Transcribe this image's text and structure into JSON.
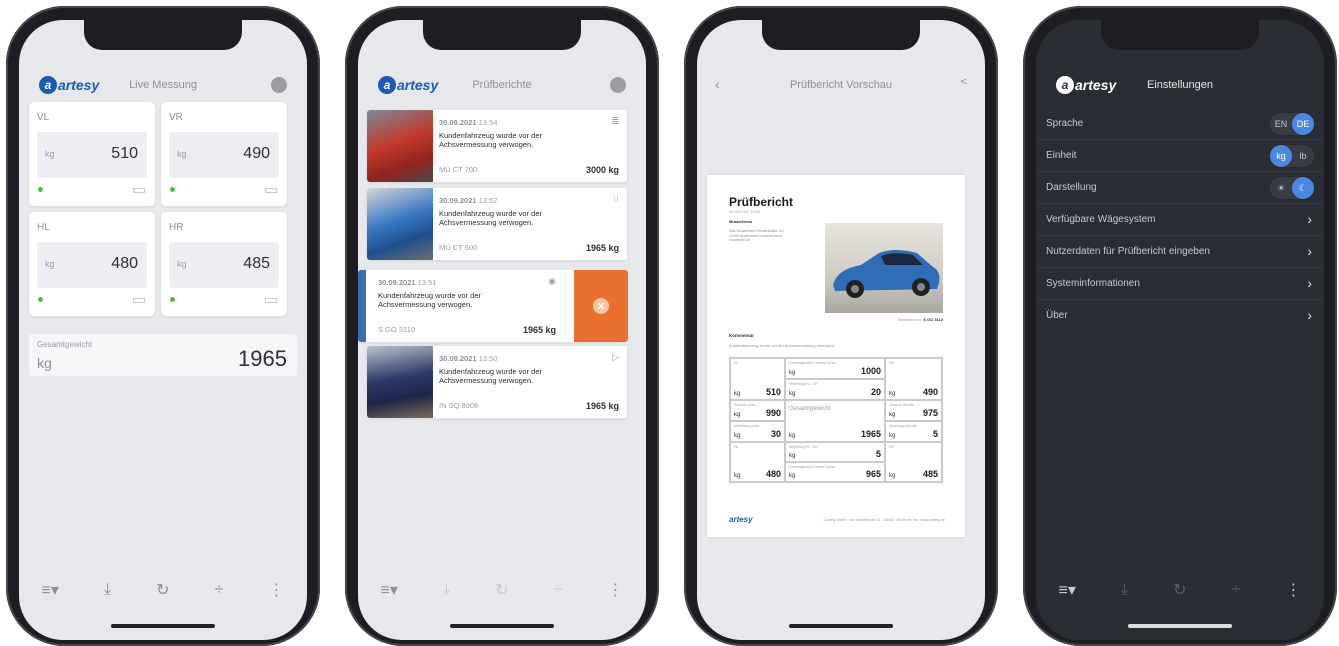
{
  "logo": {
    "text": "artesy",
    "initial": "a"
  },
  "phone1": {
    "title": "Live Messung",
    "cards": [
      {
        "label": "VL",
        "unit": "kg",
        "value": "510"
      },
      {
        "label": "VR",
        "unit": "kg",
        "value": "490"
      },
      {
        "label": "HL",
        "unit": "kg",
        "value": "480"
      },
      {
        "label": "HR",
        "unit": "kg",
        "value": "485"
      }
    ],
    "total": {
      "label": "Gesamtgewicht",
      "unit": "kg",
      "value": "1965"
    },
    "toolbar": [
      "≡▾",
      "⤓",
      "↻",
      "÷",
      "⋮"
    ]
  },
  "phone2": {
    "title": "Prüfberichte",
    "reports": [
      {
        "date": "30.09.2021",
        "time": "13:54",
        "text": "Kundenfahrzeug wurde vor der Achsvermessung verwogen.",
        "plate": "MÜ CT 700",
        "weight": "3000 kg",
        "icon": "≣"
      },
      {
        "date": "30.09.2021",
        "time": "13:52",
        "text": "Kundenfahrzeug wurde vor der Achsvermessung verwogen.",
        "plate": "MÜ CT 600",
        "weight": "1965 kg",
        "icon": "⁝⁝"
      },
      {
        "date": "30.09.2021",
        "time": "13:51",
        "text": "Kundenfahrzeug wurde vor der Achsvermessung verwogen.",
        "plate": "S GO 3110",
        "weight": "1965 kg",
        "icon": "◉"
      },
      {
        "date": "30.09.2021",
        "time": "13:50",
        "text": "Kundenfahrzeug wurde vor der Achsvermessung verwogen.",
        "plate": "IN SQ 8008",
        "weight": "1965 kg",
        "icon": "▷"
      }
    ],
    "delete_icon": "✕",
    "toolbar": [
      "≡▾",
      "⤓",
      "↻",
      "÷",
      "⋮"
    ]
  },
  "phone3": {
    "title": "Prüfbericht Vorschau",
    "back": "‹",
    "share": "<",
    "doc": {
      "title": "Prüfbericht",
      "date": "30.09.2021 14:00",
      "company": "Musterfirma",
      "address": "Max Mustermann Musterstraße 111 12345 Musterstadt musterfirma.de musterinfo.de",
      "plate_label": "Kennzeichen:",
      "plate": "S GO 3110",
      "comment_heading": "Kommentar",
      "comment": "Kundenfahrzeug wurde vor der Achsvermessung verwogen.",
      "cells": {
        "vl": {
          "label": "VL",
          "unit": "kg",
          "value": "510"
        },
        "vr": {
          "label": "VR",
          "unit": "kg",
          "value": "490"
        },
        "hl": {
          "label": "HL",
          "unit": "kg",
          "value": "480"
        },
        "hr": {
          "label": "HR",
          "unit": "kg",
          "value": "485"
        },
        "front": {
          "label": "Gesamtgewicht vordere Achse",
          "unit": "kg",
          "value": "1000"
        },
        "vdiff": {
          "label": "Verteilung VL / VR",
          "unit": "kg",
          "value": "20"
        },
        "left": {
          "label": "Gewicht Links",
          "unit": "kg",
          "value": "990"
        },
        "total": {
          "label": "Gesamtgewicht",
          "unit": "kg",
          "value": "1965"
        },
        "right": {
          "label": "Gewicht Rechts",
          "unit": "kg",
          "value": "975"
        },
        "ldist": {
          "label": "Verteilung Links",
          "unit": "kg",
          "value": "30"
        },
        "rdist": {
          "label": "Verteilung Rechts",
          "unit": "kg",
          "value": "5"
        },
        "hdiff": {
          "label": "Verteilung HL / HR",
          "unit": "kg",
          "value": "5"
        },
        "rear": {
          "label": "Gesamtgewicht hintere Achse",
          "unit": "kg",
          "value": "965"
        }
      },
      "footer_logo": "artesy",
      "footer": "Cartesy GmbH · Am Industriepark 11 · 85435 · Wörth am Inn · www.cartesy.de"
    }
  },
  "phone4": {
    "title": "Einstellungen",
    "rows": [
      {
        "label": "Sprache",
        "options": [
          "EN",
          "DE"
        ],
        "selected": 1
      },
      {
        "label": "Einheit",
        "options": [
          "kg",
          "lb"
        ],
        "selected": 0
      },
      {
        "label": "Darstellung",
        "options": [
          "☀",
          "☾"
        ],
        "selected": 1
      },
      {
        "label": "Verfügbare Wägesystem"
      },
      {
        "label": "Nutzerdaten für Prüfbericht eingeben"
      },
      {
        "label": "Systeminformationen"
      },
      {
        "label": "Über"
      }
    ],
    "chevron": "›",
    "toolbar": [
      "≡▾",
      "⤓",
      "↻",
      "÷",
      "⋮"
    ]
  },
  "colors": {
    "accent": "#1d5bb3",
    "delete": "#ea7030",
    "ok": "#4cbf3a",
    "dark_bg": "#2b2d35"
  }
}
